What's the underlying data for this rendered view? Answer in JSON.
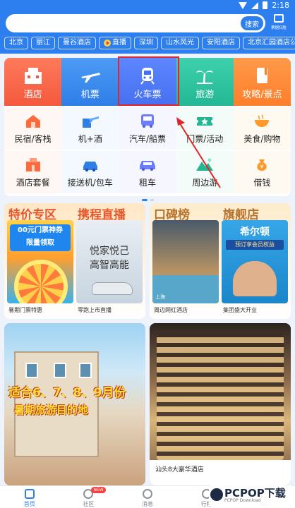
{
  "status_bar": {
    "time": "2:18"
  },
  "search": {
    "button_label": "搜索",
    "scan_label": "票据扫脸"
  },
  "quick_tags": [
    "北京",
    "丽江",
    "曼谷酒店",
    "直播",
    "深圳",
    "山水风光",
    "安阳酒店",
    "北京汇园酒店公寓"
  ],
  "categories": [
    {
      "label": "酒店",
      "icon": "hotel-icon"
    },
    {
      "label": "机票",
      "icon": "airplane-icon"
    },
    {
      "label": "火车票",
      "icon": "train-icon"
    },
    {
      "label": "旅游",
      "icon": "palm-tree-icon"
    },
    {
      "label": "攻略/景点",
      "icon": "guide-book-icon"
    }
  ],
  "services_row1": [
    {
      "label": "民宿/客栈",
      "icon": "homestay-icon"
    },
    {
      "label": "机+酒",
      "icon": "flight-hotel-icon"
    },
    {
      "label": "汽车/船票",
      "icon": "bus-icon"
    },
    {
      "label": "门票/活动",
      "icon": "ticket-icon"
    },
    {
      "label": "美食/购物",
      "icon": "food-icon"
    }
  ],
  "services_row2": [
    {
      "label": "酒店套餐",
      "icon": "hotel-package-icon"
    },
    {
      "label": "接送机/包车",
      "icon": "car-pickup-icon"
    },
    {
      "label": "租车",
      "icon": "rental-car-icon"
    },
    {
      "label": "周边游",
      "icon": "mountain-icon"
    },
    {
      "label": "借钱",
      "icon": "money-bag-icon"
    }
  ],
  "promo_left": {
    "heading_1": "特价专区",
    "heading_2": "携程直播",
    "tile1_text_1": "00元门票神券",
    "tile1_text_2": "限量领取",
    "tile2_text_1": "悦家悦己",
    "tile2_text_2": "高智高能",
    "caption_1": "暑期门票特惠",
    "caption_2": "零跑上市直播"
  },
  "promo_right": {
    "heading_1": "口碑榜",
    "heading_2": "旗舰店",
    "tile1_tag": "上海",
    "tile2_title": "希尔顿",
    "tile2_sub": "预订享会员权益",
    "caption_1": "周边网红酒店",
    "caption_2": "集团盛大开业"
  },
  "feed_left": {
    "headline": "适合6、7、8、9月份",
    "subline": "暑期旅游目的地"
  },
  "feed_right": {
    "caption": "汕头8大豪华酒店"
  },
  "bottom_nav": [
    {
      "label": "首页",
      "icon": "home-icon"
    },
    {
      "label": "社区",
      "icon": "community-icon",
      "badge": "NEW"
    },
    {
      "label": "消息",
      "icon": "message-icon"
    },
    {
      "label": "行程",
      "icon": "itinerary-icon"
    },
    {
      "label": "我的",
      "icon": "profile-icon"
    }
  ],
  "watermark": {
    "main": "PCPOP下载",
    "sub": "PCPOP Download"
  },
  "colors": {
    "brand": "#2d7ff0",
    "annotation": "#e0262b"
  }
}
